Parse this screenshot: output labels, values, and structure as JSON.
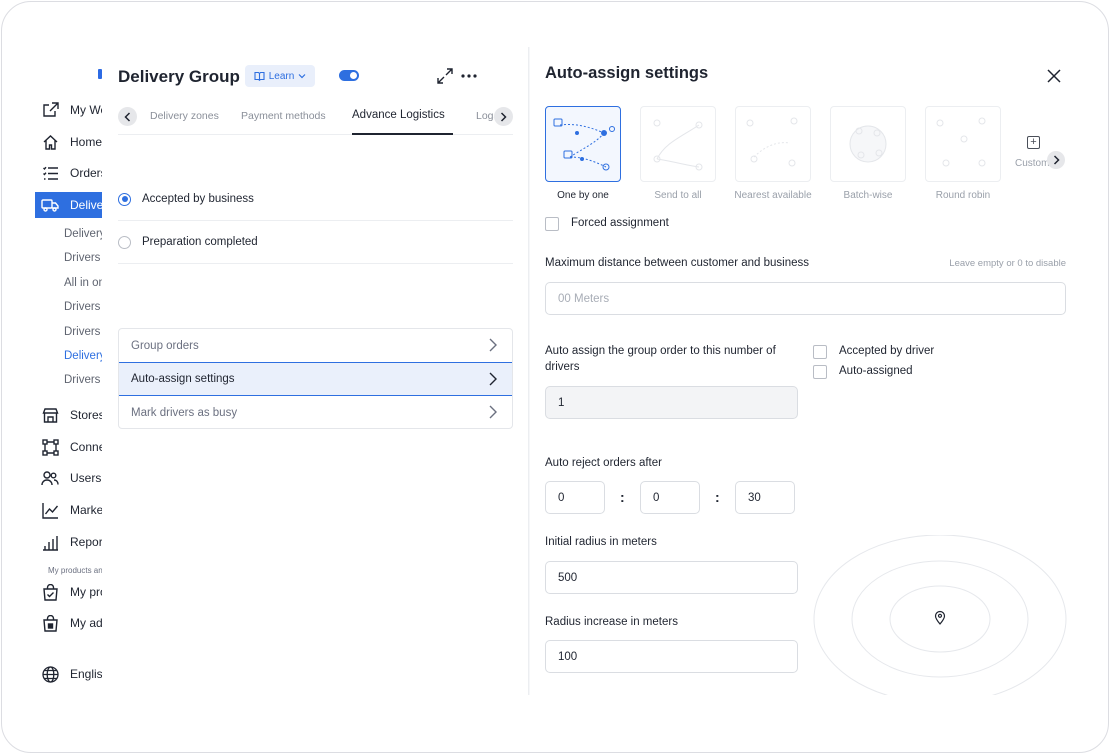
{
  "sidebar": {
    "items": [
      {
        "label": "My Website",
        "icon": "external-link-icon"
      },
      {
        "label": "Home",
        "icon": "home-icon"
      },
      {
        "label": "Orders",
        "icon": "list-icon"
      },
      {
        "label": "Delivery",
        "icon": "truck-icon"
      },
      {
        "label": "Stores",
        "icon": "store-icon"
      },
      {
        "label": "Connect",
        "icon": "network-icon"
      },
      {
        "label": "Users",
        "icon": "users-icon"
      },
      {
        "label": "Marketing",
        "icon": "trend-icon"
      },
      {
        "label": "Reports",
        "icon": "bar-chart-icon"
      },
      {
        "label": "My products",
        "icon": "bag-icon"
      },
      {
        "label": "My addons",
        "icon": "lock-bag-icon"
      },
      {
        "label": "English",
        "icon": "globe-icon"
      }
    ],
    "submenu": [
      "Delivery zones",
      "Drivers",
      "All in one",
      "Drivers groups",
      "Drivers",
      "Delivery groups",
      "Drivers"
    ],
    "caption": "My products and addons"
  },
  "group": {
    "title": "Delivery Group",
    "learn_label": "Learn",
    "tabs": [
      "Delivery zones",
      "Payment methods",
      "Advance Logistics",
      "Logs"
    ],
    "radios": [
      "Accepted by business",
      "Preparation completed"
    ],
    "menu": [
      "Group orders",
      "Auto-assign settings",
      "Mark drivers as busy"
    ]
  },
  "autoassign": {
    "title": "Auto-assign settings",
    "strategies": [
      "One by one",
      "Send to all",
      "Nearest available",
      "Batch-wise",
      "Round robin"
    ],
    "custom_label": "Custom",
    "forced_label": "Forced assignment",
    "max_distance_label": "Maximum distance between customer and business",
    "max_distance_hint": "Leave empty or 0 to disable",
    "max_distance_placeholder": "00 Meters",
    "group_drivers_label_1": "Auto assign the group order to this number of",
    "group_drivers_label_2": "drivers",
    "group_drivers_value": "1",
    "accepted_by_driver": "Accepted by driver",
    "auto_assigned": "Auto-assigned",
    "reject_label": "Auto reject orders after",
    "reject_hours": "0",
    "reject_minutes": "0",
    "reject_seconds": "30",
    "initial_radius_label": "Initial radius in meters",
    "initial_radius_value": "500",
    "radius_increase_label": "Radius increase in meters",
    "radius_increase_value": "100"
  },
  "colors": {
    "accent": "#2e6fe0",
    "selected_bg": "#eaf0fb"
  }
}
